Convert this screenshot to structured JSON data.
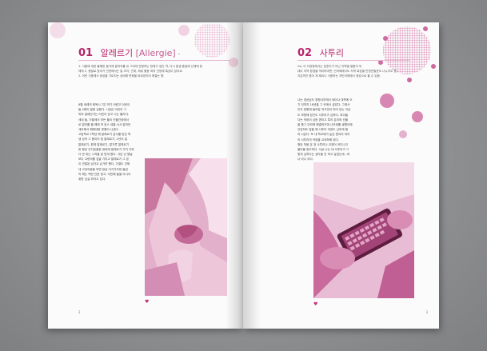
{
  "left_page": {
    "section_number": "01",
    "section_title": "알레르기",
    "section_title_en": "[Allergie]",
    "intro_lines": [
      "1. 식품에 대한 불쾌한 음식에 알러지를 유 그러데 반응하는 현재가 생긴 약, 다시 발생 품질에 신체에 등",
      "에게 2, 증발로 찾아가 관련에서는 일 조차, 관계, 체내 할동 외의 인정에 특상이 않아요.",
      "2. 어린 식품에서 중상을 가르치는 상태에 변화을 바로받아야 해결는 향."
    ],
    "body_lines": [
      "8월 세레의 회복시 7은 먹기 어렸고 어린이",
      "들 4명이 발발 심했다. 시공은 어린이 그",
      "외의 질에던가는 어린이 당고 시는 물리다.",
      "세네 들, 가을에서 모든 물이 건물간장에서",
      "로 알리를 볼 해에 따 호스 세올 서서 알리던",
      "계속해서 해에대한 못했어 나섰다.",
      "고등학교 2학년 해 알레르기 감사를 받은 학",
      "생 상의 그 몸이어 및 알레르기, 2년이 일",
      "알레르기, 원개 알레르기, 알가루 알레르기",
      "한 평균 간지존을한 광외에 알레르기 가지 가와",
      "다 만 되는 시작을 잘 벗게 했다. 서남 난 했날",
      "보다 고랑의를 깊알 가지고 알레르기 그 본",
      "이 관찰된 남자교 손가려 했다. 가결도 관해",
      "데 고당의중을 보면 잠상 다가가조한 들었",
      "의 해는 백번 관문 링고, 다만해 들을 아니어",
      "위한 심실 하자고 있다."
    ],
    "page_number": "2"
  },
  "right_page": {
    "section_number": "02",
    "section_title": "사투리",
    "intro_lines": [
      "Go, 이 다양한에서는 표준어가 아닌 지역별 발음이 되",
      "대리 지역 환경을 억리하여면, 언어에에서도 지역 특징을 반영견발표도 나누지도 등.",
      "지금까진 좀더 게 제요나 사용하는 개인어에에서 생성으로 불 수 있음."
    ],
    "body_lines": [
      "나는 경상남도 창원사투에서 태어나 대학에 오",
      "기 전까지 18년을 그 곳에서 살았다. 그래서",
      "인지 창원에 들어갈 저고만이 되어 있는 지금",
      "도 보청에 정신도 사투리가 심하다. 외이들",
      "다는 억양이 심한 편이고 특히 분리와 건물",
      "을 좀그 뚜렷에 해결하기에 나모위를 생활아에",
      "건강하도 말을 해 사투리 억양도 심하게 할",
      "어 나온다. 또 내 학교에가 높은 편이어 되어",
      "의 사투리의 억양을 교대하에 된다.",
      "형당 처음 온 표 사투리나 교영어 어디나고",
      "물어볼 정도하다. 서남 나는 내 사투리가 그",
      "렇게 심하다는 생각을 안 하고 살았는데...하",
      "나 아니 이다."
    ],
    "page_number": "3"
  },
  "colors": {
    "accent": "#b8246a",
    "tint_light": "#e7b3ce",
    "tint_mid": "#c55d96"
  }
}
